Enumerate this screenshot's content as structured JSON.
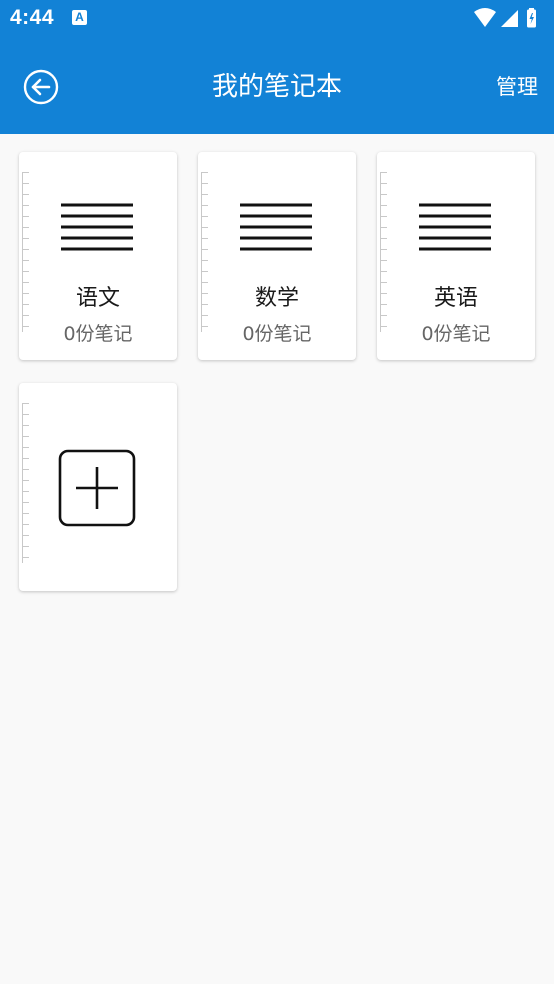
{
  "status_bar": {
    "time": "4:44",
    "notification_icon": "A"
  },
  "header": {
    "title": "我的笔记本",
    "manage_label": "管理",
    "back_icon": "back-arrow-circle-icon"
  },
  "notebooks": [
    {
      "name": "语文",
      "count": "0份笔记"
    },
    {
      "name": "数学",
      "count": "0份笔记"
    },
    {
      "name": "英语",
      "count": "0份笔记"
    }
  ],
  "add_card": {
    "icon": "plus-square-icon"
  },
  "colors": {
    "primary": "#1282d6",
    "background": "#f9f9f9",
    "card": "#ffffff",
    "subtext": "#666666"
  }
}
